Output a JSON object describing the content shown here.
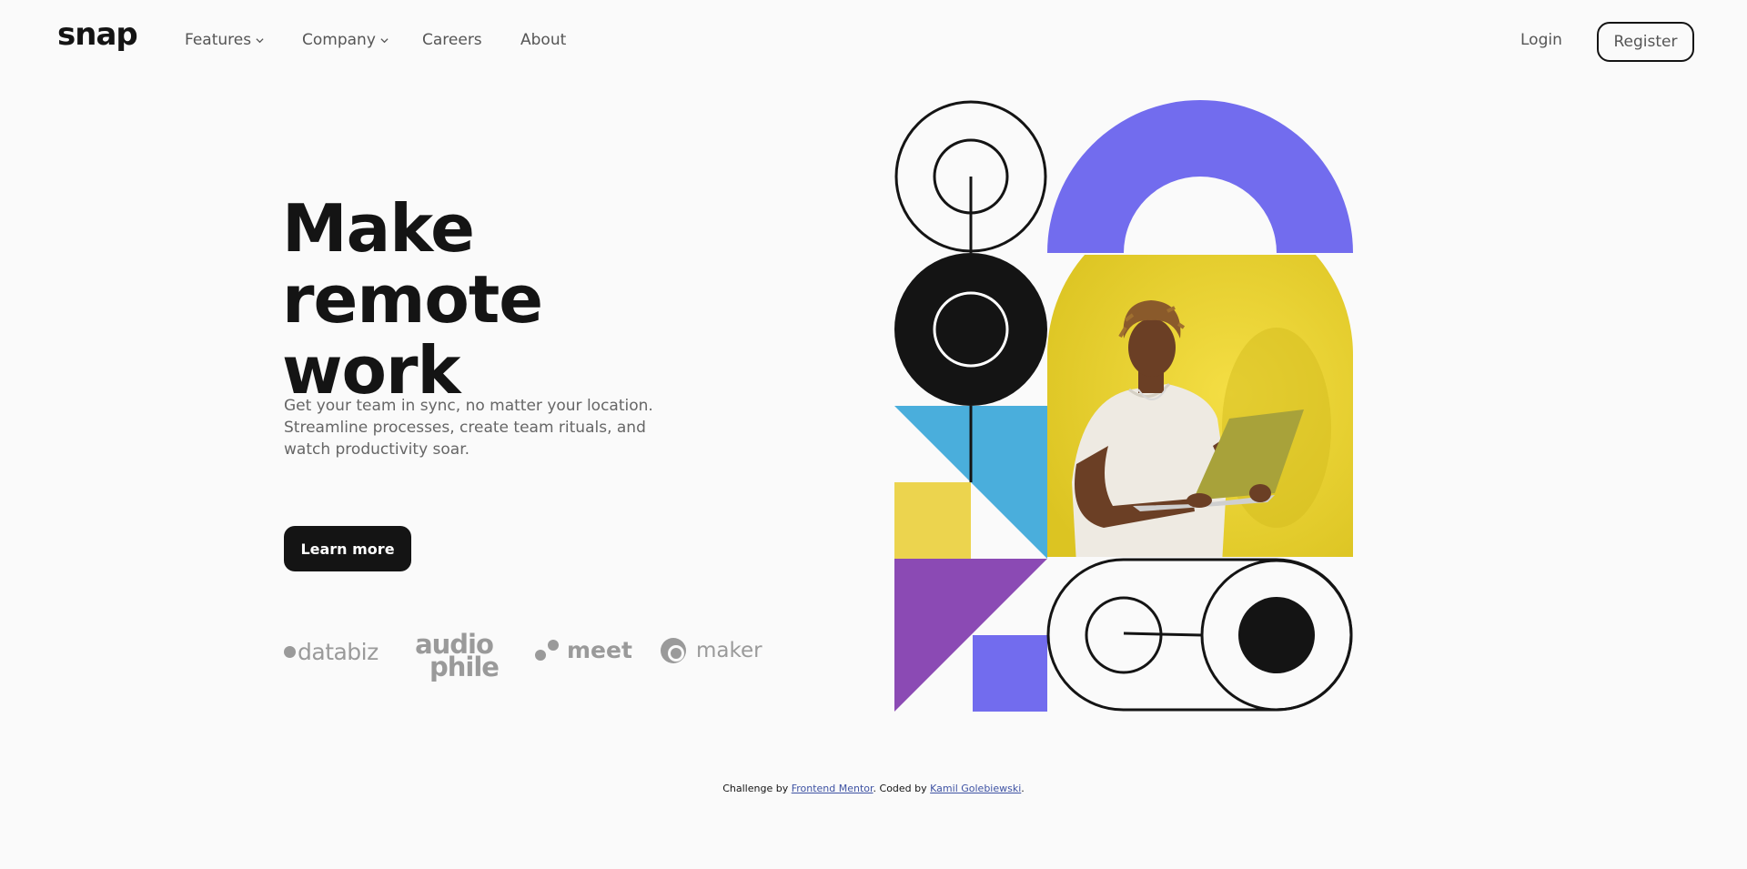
{
  "header": {
    "logo": "snap",
    "nav": [
      {
        "label": "Features",
        "dropdown": true
      },
      {
        "label": "Company",
        "dropdown": true
      },
      {
        "label": "Careers",
        "dropdown": false
      },
      {
        "label": "About",
        "dropdown": false
      }
    ],
    "login_label": "Login",
    "register_label": "Register"
  },
  "hero": {
    "headline_line1": "Make remote",
    "headline_line2": "work",
    "lead": "Get your team in sync, no matter your location. Streamline processes, create team rituals, and watch productivity soar.",
    "cta_label": "Learn more",
    "clients": [
      "databiz",
      "audio",
      "phile",
      "meet",
      "maker"
    ]
  },
  "footer": {
    "prefix": "Challenge by ",
    "link1": "Frontend Mentor",
    "middle": ". Coded by ",
    "link2": "Kamil Golebiewski",
    "suffix": "."
  },
  "colors": {
    "dark": "#141414",
    "purple": "#726cee",
    "yellow": "#ecd02d",
    "blue": "#4aaedc",
    "violet": "#8b4ab4",
    "background": "#fafafa"
  }
}
